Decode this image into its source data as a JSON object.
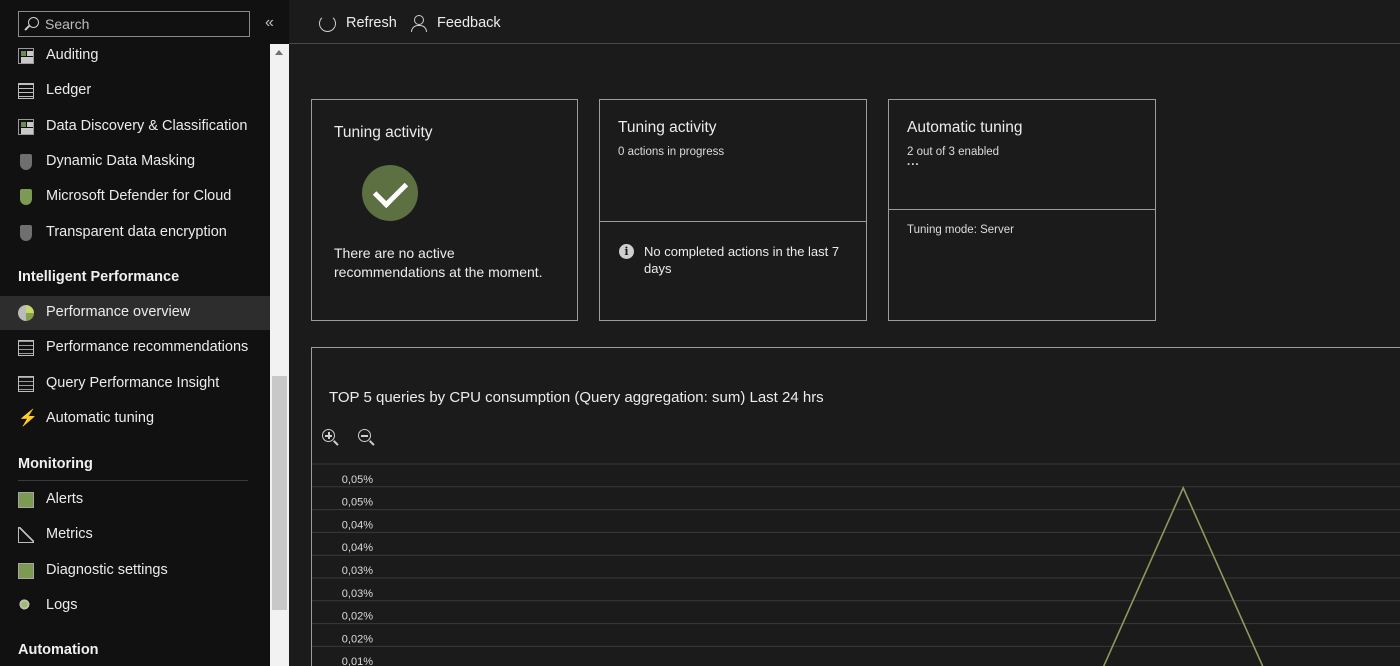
{
  "sidebar": {
    "search": {
      "placeholder": "Search"
    },
    "collapse_glyph": "«",
    "items_top": [
      {
        "label": "Auditing",
        "icon": "auditing-icon"
      },
      {
        "label": "Ledger",
        "icon": "ledger-icon"
      },
      {
        "label": "Data Discovery & Classification",
        "icon": "data-discovery-icon"
      },
      {
        "label": "Dynamic Data Masking",
        "icon": "data-masking-icon"
      },
      {
        "label": "Microsoft Defender for Cloud",
        "icon": "defender-shield-icon"
      },
      {
        "label": "Transparent data encryption",
        "icon": "encryption-shield-icon"
      }
    ],
    "sections": [
      {
        "title": "Intelligent Performance",
        "items": [
          {
            "label": "Performance overview",
            "icon": "gauge-icon",
            "selected": true
          },
          {
            "label": "Performance recommendations",
            "icon": "recommendations-icon"
          },
          {
            "label": "Query Performance Insight",
            "icon": "query-insight-icon"
          },
          {
            "label": "Automatic tuning",
            "icon": "lightning-icon"
          }
        ]
      },
      {
        "title": "Monitoring",
        "items": [
          {
            "label": "Alerts",
            "icon": "alerts-icon"
          },
          {
            "label": "Metrics",
            "icon": "metrics-icon"
          },
          {
            "label": "Diagnostic settings",
            "icon": "diagnostic-icon"
          },
          {
            "label": "Logs",
            "icon": "logs-icon"
          }
        ]
      },
      {
        "title": "Automation",
        "items": []
      }
    ]
  },
  "toolbar": {
    "refresh_label": "Refresh",
    "feedback_label": "Feedback"
  },
  "cards": {
    "tuning_status": {
      "title": "Tuning activity",
      "message": "There are no active recommendations at the moment."
    },
    "tuning_activity": {
      "title": "Tuning activity",
      "subtitle": "0 actions in progress",
      "info_text": "No completed actions in the last 7 days"
    },
    "automatic_tuning": {
      "title": "Automatic tuning",
      "subtitle": "2 out of 3 enabled",
      "ellipsis": "...",
      "mode_text": "Tuning mode: Server"
    }
  },
  "chart": {
    "title": "TOP 5 queries by CPU consumption (Query aggregation: sum) Last 24 hrs",
    "line_color": "#8a9a5b"
  },
  "chart_data": {
    "type": "line",
    "title": "TOP 5 queries by CPU consumption (Query aggregation: sum) Last 24 hrs",
    "y_tick_labels": [
      "0,05%",
      "0,05%",
      "0,04%",
      "0,04%",
      "0,03%",
      "0,03%",
      "0,02%",
      "0,02%",
      "0,01%"
    ],
    "ylim": [
      0,
      0.055
    ],
    "grid": true,
    "series": [
      {
        "points": [
          {
            "x": 0.72,
            "y": 0.0
          },
          {
            "x": 0.8,
            "y": 0.049
          },
          {
            "x": 0.88,
            "y": 0.0
          }
        ]
      }
    ]
  }
}
